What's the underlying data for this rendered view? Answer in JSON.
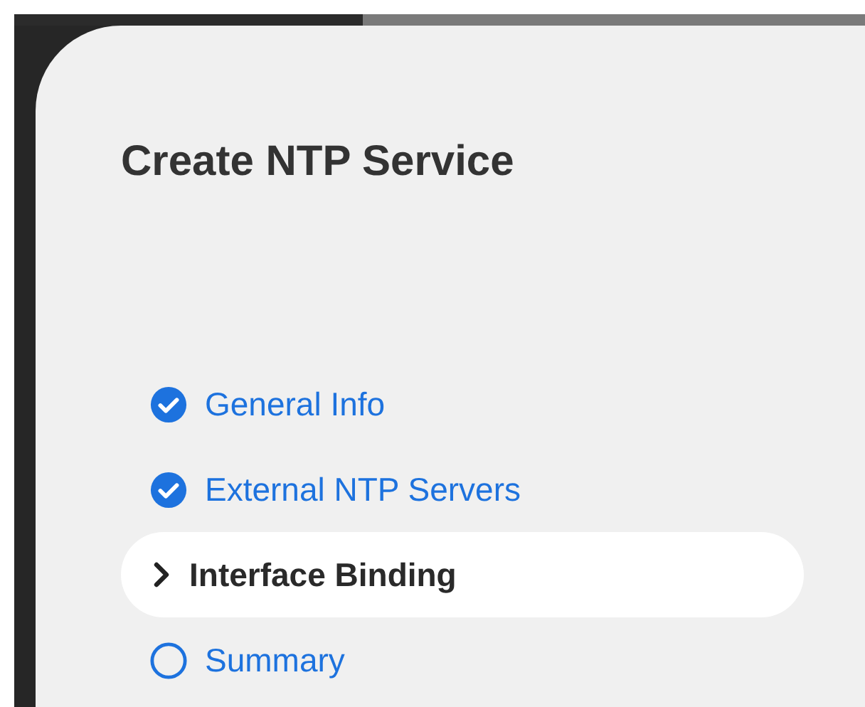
{
  "dialog": {
    "title": "Create NTP Service"
  },
  "steps": [
    {
      "label": "General Info",
      "kind": "done",
      "selected": false
    },
    {
      "label": "External NTP Servers",
      "kind": "done",
      "selected": false
    },
    {
      "label": "Interface Binding",
      "kind": "current",
      "selected": true
    },
    {
      "label": "Summary",
      "kind": "todo",
      "selected": false
    }
  ]
}
